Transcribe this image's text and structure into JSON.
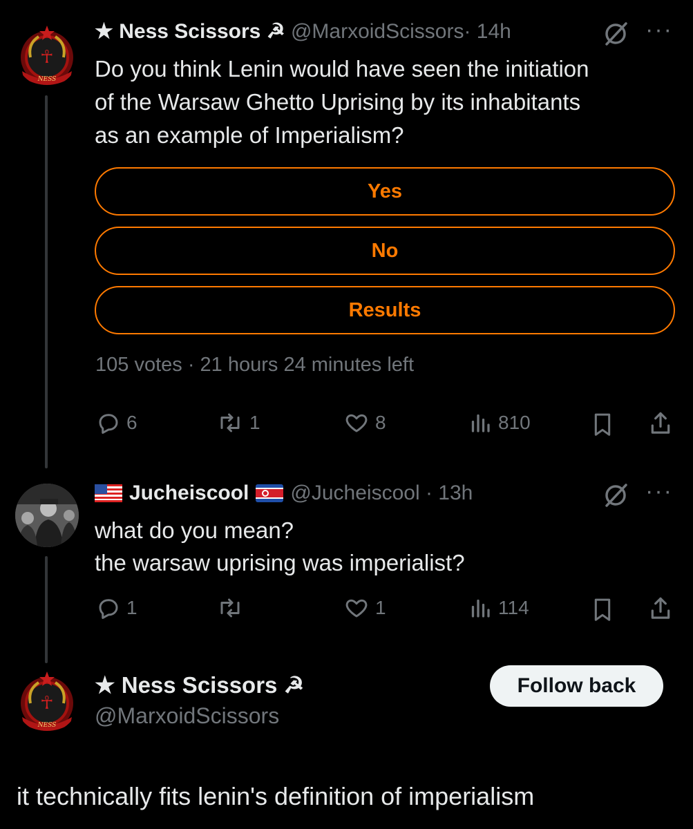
{
  "colors": {
    "accent": "#ff7a00",
    "muted": "#71767b",
    "text": "#e7e9ea",
    "background": "#000000"
  },
  "post1": {
    "display_name": "★ Ness Scissors ☭",
    "handle": "@MarxoidScissors",
    "time": "· 14h",
    "text_lines": [
      "Do you think Lenin would have seen the initiation",
      "of the Warsaw Ghetto Uprising by its inhabitants",
      "as an example of Imperialism?"
    ],
    "poll": {
      "options": [
        "Yes",
        "No",
        "Results"
      ],
      "footer": "105 votes · 21 hours 24 minutes left"
    },
    "actions": {
      "replies": "6",
      "reposts": "1",
      "likes": "8",
      "views": "810"
    }
  },
  "post2": {
    "display_name": "Jucheiscool",
    "handle": "@Jucheiscool",
    "time": "· 13h",
    "text_lines": [
      "what do you mean?",
      "the warsaw uprising was imperialist?"
    ],
    "actions": {
      "replies": "1",
      "reposts": "",
      "likes": "1",
      "views": "114"
    }
  },
  "post3": {
    "display_name": "★ Ness Scissors ☭",
    "handle": "@MarxoidScissors",
    "follow_label": "Follow back",
    "text": "it technically fits lenin's definition of imperialism"
  },
  "avatar_text": "NESS"
}
